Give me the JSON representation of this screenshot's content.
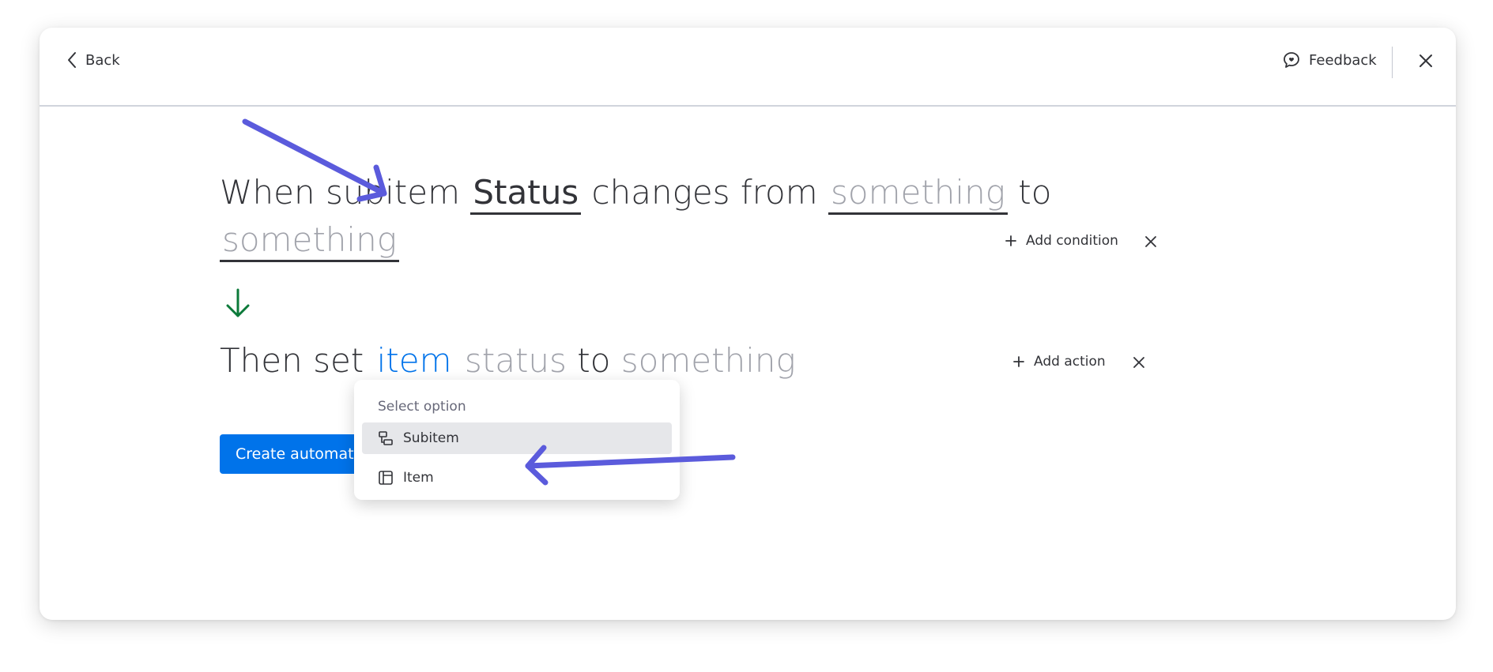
{
  "header": {
    "back_label": "Back",
    "feedback_label": "Feedback"
  },
  "trigger": {
    "part1": "When subitem ",
    "status_token": "Status",
    "part2": " changes from ",
    "from_token": "something",
    "part3": " to",
    "to_token": "something"
  },
  "action": {
    "prefix": "Then set ",
    "target_token": "item",
    "field_text": " status",
    "to_text": " to ",
    "value_text": "something"
  },
  "row_controls": {
    "add_condition_label": "Add condition",
    "add_action_label": "Add action"
  },
  "create_button_label": "Create automation",
  "dropdown": {
    "header": "Select option",
    "options": [
      {
        "label": "Subitem",
        "icon": "subitem-icon",
        "highlighted": true
      },
      {
        "label": "Item",
        "icon": "item-icon",
        "highlighted": false
      }
    ]
  },
  "colors": {
    "primary_blue": "#0073ea",
    "text_dark": "#323338",
    "text_muted": "#a1a3ab",
    "arrow_green": "#0c7a3a",
    "annotation_arrow": "#5b5bdc"
  }
}
